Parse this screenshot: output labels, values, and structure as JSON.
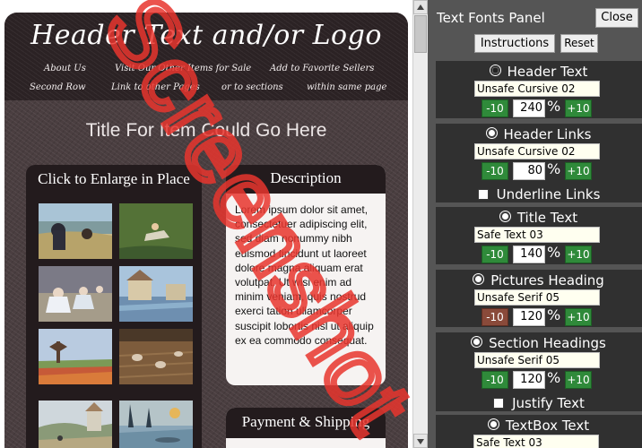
{
  "preview": {
    "header_title": "Header Text and/or Logo",
    "nav_row_1": [
      "About Us",
      "Visit Our Other Items for Sale",
      "Add to Favorite Sellers"
    ],
    "nav_row_2": [
      "Second Row",
      "Link to other Pages",
      "or to sections",
      "within same page"
    ],
    "item_title": "Title For Item Could Go Here",
    "pictures_heading": "Click to Enlarge in Place",
    "description_heading": "Description",
    "description_text": "Lorem ipsum dolor sit amet, consectetuer adipiscing elit, sed diam nonummy nibh euismod tincidunt ut laoreet dolore magna aliquam erat volutpat. Ut wisi enim ad minim veniam, quis nostrud exerci tation ullamcorper suscipit lobortis nisl ut aliquip ex ea commodo consequat.",
    "payment_heading": "Payment & Shipping",
    "watermark_text": "Screenshot",
    "watermark_color": "#e8352e"
  },
  "panel": {
    "title": "Text Fonts Panel",
    "close_label": "Close",
    "instructions_label": "Instructions",
    "reset_label": "Reset",
    "percent_sign": "%",
    "minus_label": "-10",
    "plus_label": "+10",
    "sections": [
      {
        "title": "Header Text",
        "font": "Unsafe Cursive 02",
        "size": "240",
        "selected": true
      },
      {
        "title": "Header Links",
        "font": "Unsafe Cursive 02",
        "size": "80",
        "checkbox": "Underline Links"
      },
      {
        "title": "Title Text",
        "font": "Safe Text 03",
        "size": "140"
      },
      {
        "title": "Pictures Heading",
        "font": "Unsafe Serif 05",
        "size": "120"
      },
      {
        "title": "Section Headings",
        "font": "Unsafe Serif 05",
        "size": "120",
        "checkbox": "Justify Text"
      },
      {
        "title": "TextBox Text",
        "font": "Safe Text 03"
      }
    ]
  }
}
